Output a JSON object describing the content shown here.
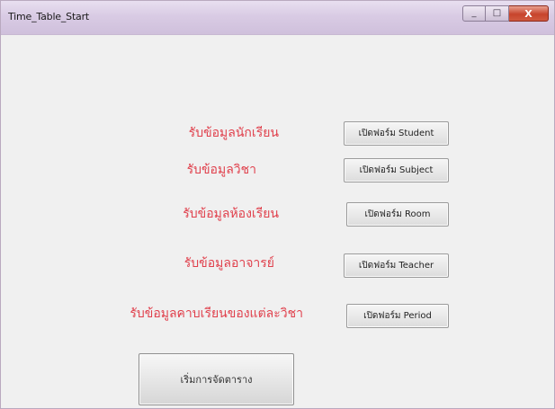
{
  "window": {
    "title": "Time_Table_Start",
    "minimize_glyph": "_",
    "maximize_glyph": "□",
    "close_glyph": "X"
  },
  "rows": [
    {
      "label": "รับข้อมูลนักเรียน",
      "button": "เปิดฟอร์ม Student"
    },
    {
      "label": "รับข้อมูลวิชา",
      "button": "เปิดฟอร์ม Subject"
    },
    {
      "label": "รับข้อมูลห้องเรียน",
      "button": "เปิดฟอร์ม Room"
    },
    {
      "label": "รับข้อมูลอาจารย์",
      "button": "เปิดฟอร์ม Teacher"
    },
    {
      "label": "รับข้อมูลคาบเรียนของแต่ละวิชา",
      "button": "เปิดฟอร์ม Period"
    }
  ],
  "start_button": "เริ่มการจัดตาราง",
  "colors": {
    "label_red": "#e0404c",
    "title_bar": "#d9cbe4",
    "close_red": "#c7442c"
  }
}
